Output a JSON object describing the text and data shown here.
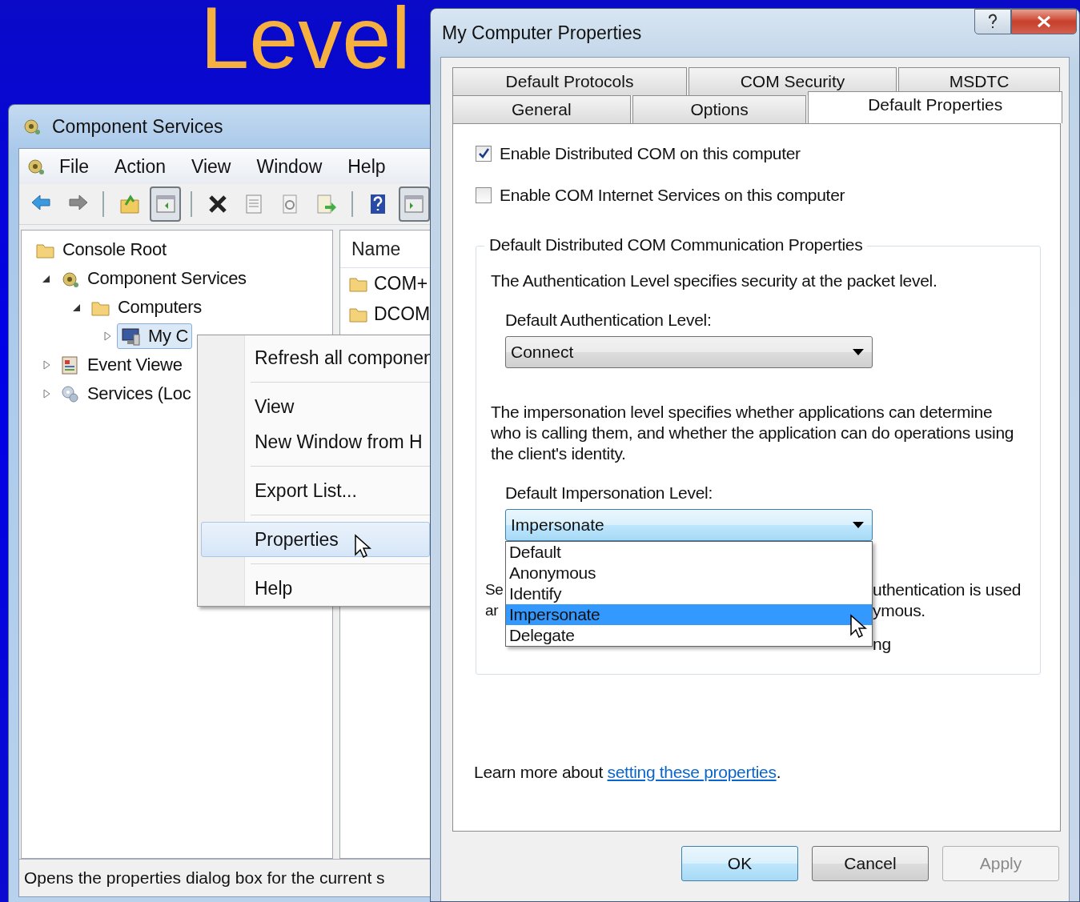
{
  "slide_title": "Level",
  "component_services": {
    "title": "Component Services",
    "menu": [
      "File",
      "Action",
      "View",
      "Window",
      "Help"
    ],
    "toolbar": [
      {
        "kind": "back",
        "pressed": false
      },
      {
        "kind": "forward",
        "pressed": false
      },
      {
        "kind": "separator"
      },
      {
        "kind": "up",
        "pressed": false
      },
      {
        "kind": "tree",
        "pressed": true
      },
      {
        "kind": "separator"
      },
      {
        "kind": "delete",
        "pressed": false
      },
      {
        "kind": "properties",
        "pressed": false
      },
      {
        "kind": "refresh",
        "pressed": false
      },
      {
        "kind": "export",
        "pressed": false
      },
      {
        "kind": "separator"
      },
      {
        "kind": "help",
        "pressed": false
      },
      {
        "kind": "actions",
        "pressed": true
      }
    ],
    "tree": [
      {
        "label": "Console Root",
        "kind": "folder",
        "selected": false,
        "children": [
          {
            "label": "Component Services",
            "kind": "component",
            "expanded": true,
            "selected": false,
            "children": [
              {
                "label": "Computers",
                "kind": "folder",
                "expanded": true,
                "selected": false,
                "children": [
                  {
                    "label": "My C",
                    "kind": "computer",
                    "expanded": false,
                    "selected": true
                  }
                ]
              }
            ]
          },
          {
            "label": "Event Viewe",
            "kind": "events",
            "expanded": false,
            "selected": false
          },
          {
            "label": "Services (Loc",
            "kind": "services",
            "expanded": false,
            "selected": false
          }
        ]
      }
    ],
    "list": {
      "columns": [
        "Name"
      ],
      "rows": [
        {
          "name": "COM+"
        },
        {
          "name": "DCOM"
        }
      ]
    },
    "status_bar": "Opens the properties dialog box for the current s",
    "context_menu": [
      {
        "label": "Refresh all componen",
        "selected": false
      },
      {
        "kind": "separator"
      },
      {
        "label": "View",
        "selected": false
      },
      {
        "label": "New Window from H",
        "selected": false
      },
      {
        "kind": "separator"
      },
      {
        "label": "Export List...",
        "selected": false
      },
      {
        "kind": "separator"
      },
      {
        "label": "Properties",
        "selected": true
      },
      {
        "kind": "separator"
      },
      {
        "label": "Help",
        "selected": false
      }
    ]
  },
  "dialog": {
    "title": "My Computer Properties",
    "tab_rows": [
      [
        {
          "label": "Default Protocols",
          "selected": false
        },
        {
          "label": "COM Security",
          "selected": false
        },
        {
          "label": "MSDTC",
          "selected": false
        }
      ],
      [
        {
          "label": "General",
          "selected": false
        },
        {
          "label": "Options",
          "selected": false
        },
        {
          "label": "Default Properties",
          "selected": true
        }
      ]
    ],
    "checkboxes": [
      {
        "label": "Enable Distributed COM on this computer",
        "checked": true
      },
      {
        "label": "Enable COM Internet Services on this computer",
        "checked": false
      }
    ],
    "group": {
      "title": "Default Distributed COM Communication Properties",
      "auth_text": "The Authentication Level specifies security at the packet level.",
      "auth_label": "Default Authentication Level:",
      "auth_combo": {
        "value": "Connect",
        "open": false
      },
      "imp_text": "The impersonation level specifies whether applications can determine who is calling them, and whether the application can do operations using the client's identity.",
      "imp_label": "Default Impersonation Level:",
      "imp_combo": {
        "value": "Impersonate",
        "open": true,
        "options": [
          {
            "label": "Default",
            "selected": false
          },
          {
            "label": "Anonymous",
            "selected": false
          },
          {
            "label": "Identify",
            "selected": false
          },
          {
            "label": "Impersonate",
            "selected": true
          },
          {
            "label": "Delegate",
            "selected": false
          }
        ]
      },
      "covered_text": {
        "left": [
          "Se",
          "ar"
        ],
        "right": [
          "uthentication is used",
          "ymous.",
          "ng"
        ]
      }
    },
    "learn_more": {
      "text": "Learn more about ",
      "link": "setting these properties",
      "end": "."
    },
    "buttons": [
      {
        "label": "OK",
        "disabled": false,
        "default": true
      },
      {
        "label": "Cancel",
        "disabled": false,
        "default": false
      },
      {
        "label": "Apply",
        "disabled": true,
        "default": false
      }
    ]
  }
}
